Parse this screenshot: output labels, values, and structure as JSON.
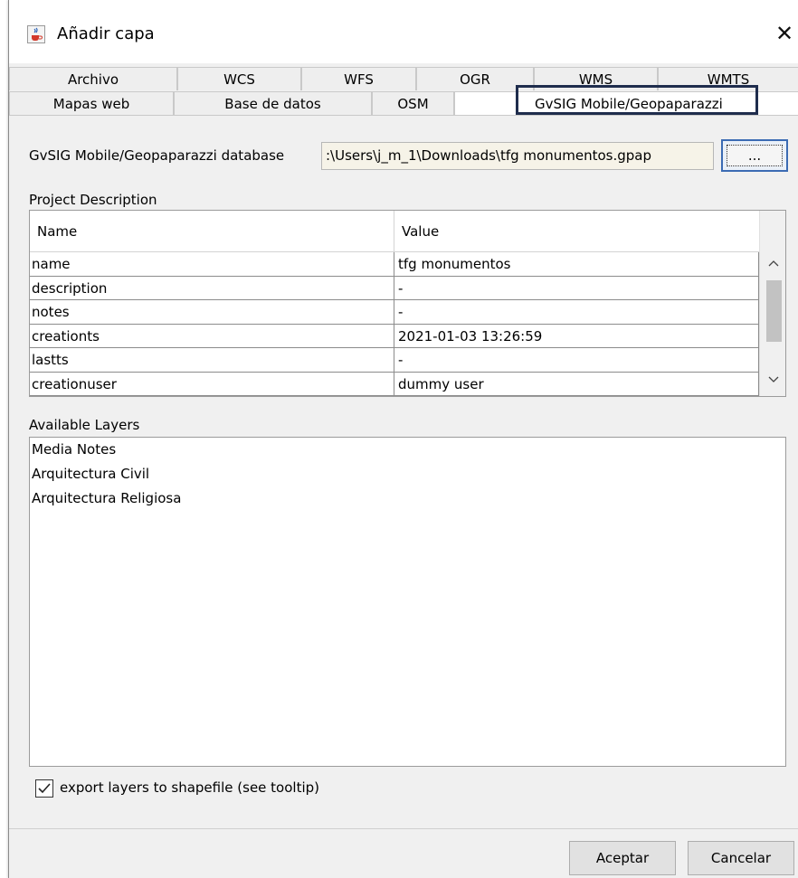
{
  "window": {
    "title": "Añadir capa",
    "close_glyph": "✕",
    "icon": "java-cup-icon"
  },
  "tabs": {
    "row1": [
      "Archivo",
      "WCS",
      "WFS",
      "OGR",
      "WMS",
      "WMTS"
    ],
    "row2": [
      "Mapas web",
      "Base de datos",
      "OSM",
      "GvSIG Mobile/Geopaparazzi"
    ],
    "active": "GvSIG Mobile/Geopaparazzi"
  },
  "database": {
    "label": "GvSIG Mobile/Geopaparazzi database",
    "path": ":\\Users\\j_m_1\\Downloads\\tfg monumentos.gpap",
    "browse_label": "..."
  },
  "project": {
    "section_label": "Project Description",
    "columns": [
      "Name",
      "Value"
    ],
    "rows": [
      [
        "name",
        "tfg monumentos"
      ],
      [
        "description",
        "-"
      ],
      [
        "notes",
        "-"
      ],
      [
        "creationts",
        "2021-01-03 13:26:59"
      ],
      [
        "lastts",
        "-"
      ],
      [
        "creationuser",
        "dummy user"
      ]
    ],
    "scroll_up": "^",
    "scroll_down": "v"
  },
  "layers": {
    "section_label": "Available Layers",
    "items": [
      "Media Notes",
      "Arquitectura Civil",
      "Arquitectura Religiosa"
    ]
  },
  "export": {
    "label": "export layers to shapefile (see tooltip)",
    "checked": true
  },
  "buttons": {
    "accept": "Aceptar",
    "cancel": "Cancelar"
  },
  "colors": {
    "highlight_border": "#1f2d4d",
    "input_bg": "#f6f3e8",
    "browse_border": "#3b6bb3"
  }
}
